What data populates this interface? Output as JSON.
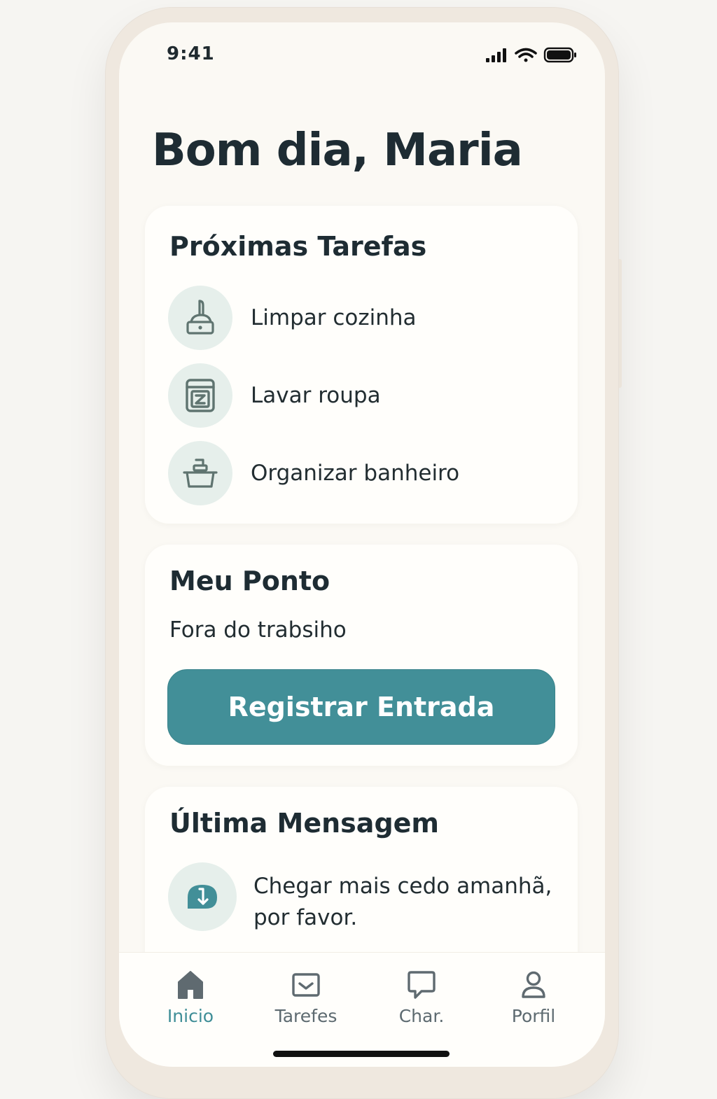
{
  "status_bar": {
    "time": "9:41"
  },
  "greeting": "Bom dia, Maria",
  "tasks": {
    "title": "Próximas Tarefas",
    "items": [
      {
        "label": "Limpar cozinha",
        "icon": "cleaning-brush-icon"
      },
      {
        "label": "Lavar roupa",
        "icon": "washing-machine-icon"
      },
      {
        "label": "Organizar banheiro",
        "icon": "basin-icon"
      }
    ]
  },
  "ponto": {
    "title": "Meu Ponto",
    "status": "Fora do trabsiho",
    "button_label": "Registrar Entrada"
  },
  "message": {
    "title": "Última Mensagem",
    "text": "Chegar mais cedo amanhã, por favor.",
    "icon": "message-arrow-icon"
  },
  "nav": {
    "items": [
      {
        "label": "Inicio",
        "icon": "home-icon",
        "active": true
      },
      {
        "label": "Tarefes",
        "icon": "inbox-icon",
        "active": false
      },
      {
        "label": "Char.",
        "icon": "chat-bubble-icon",
        "active": false
      },
      {
        "label": "Porfil",
        "icon": "user-icon",
        "active": false
      }
    ]
  },
  "colors": {
    "accent": "#428f98",
    "icon": "#5f7470",
    "icon_bg": "#e6efeb",
    "text": "#1e2c33",
    "background": "#fbf9f4"
  }
}
